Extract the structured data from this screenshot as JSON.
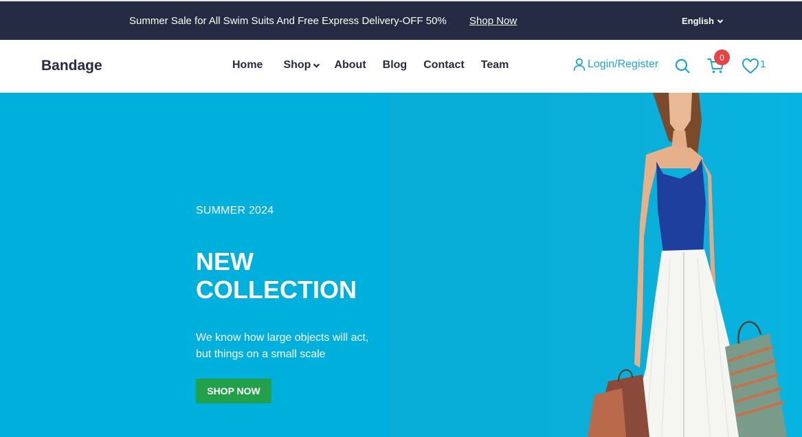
{
  "topbar": {
    "promo_text": "Summer Sale for All Swim Suits And Free Express Delivery-OFF 50%",
    "promo_link": "Shop Now",
    "language": "English"
  },
  "navbar": {
    "brand": "Bandage",
    "links": [
      {
        "label": "Home"
      },
      {
        "label": "Shop"
      },
      {
        "label": "About"
      },
      {
        "label": "Blog"
      },
      {
        "label": "Contact"
      },
      {
        "label": "Team"
      }
    ],
    "login_label": "Login/Register",
    "cart_count": "0",
    "wishlist_count": "1",
    "icons": [
      "user-icon",
      "search-icon",
      "cart-icon",
      "heart-icon"
    ],
    "accent_color": "#1aa3d6"
  },
  "hero": {
    "eyebrow": "SUMMER 2024",
    "headline_line1": "NEW",
    "headline_line2": "COLLECTION",
    "description_line1": "We know how large objects will act,",
    "description_line2": "but things on a small scale",
    "cta": "SHOP NOW",
    "background_color": "#00B0DC",
    "cta_color": "#23a04a"
  }
}
